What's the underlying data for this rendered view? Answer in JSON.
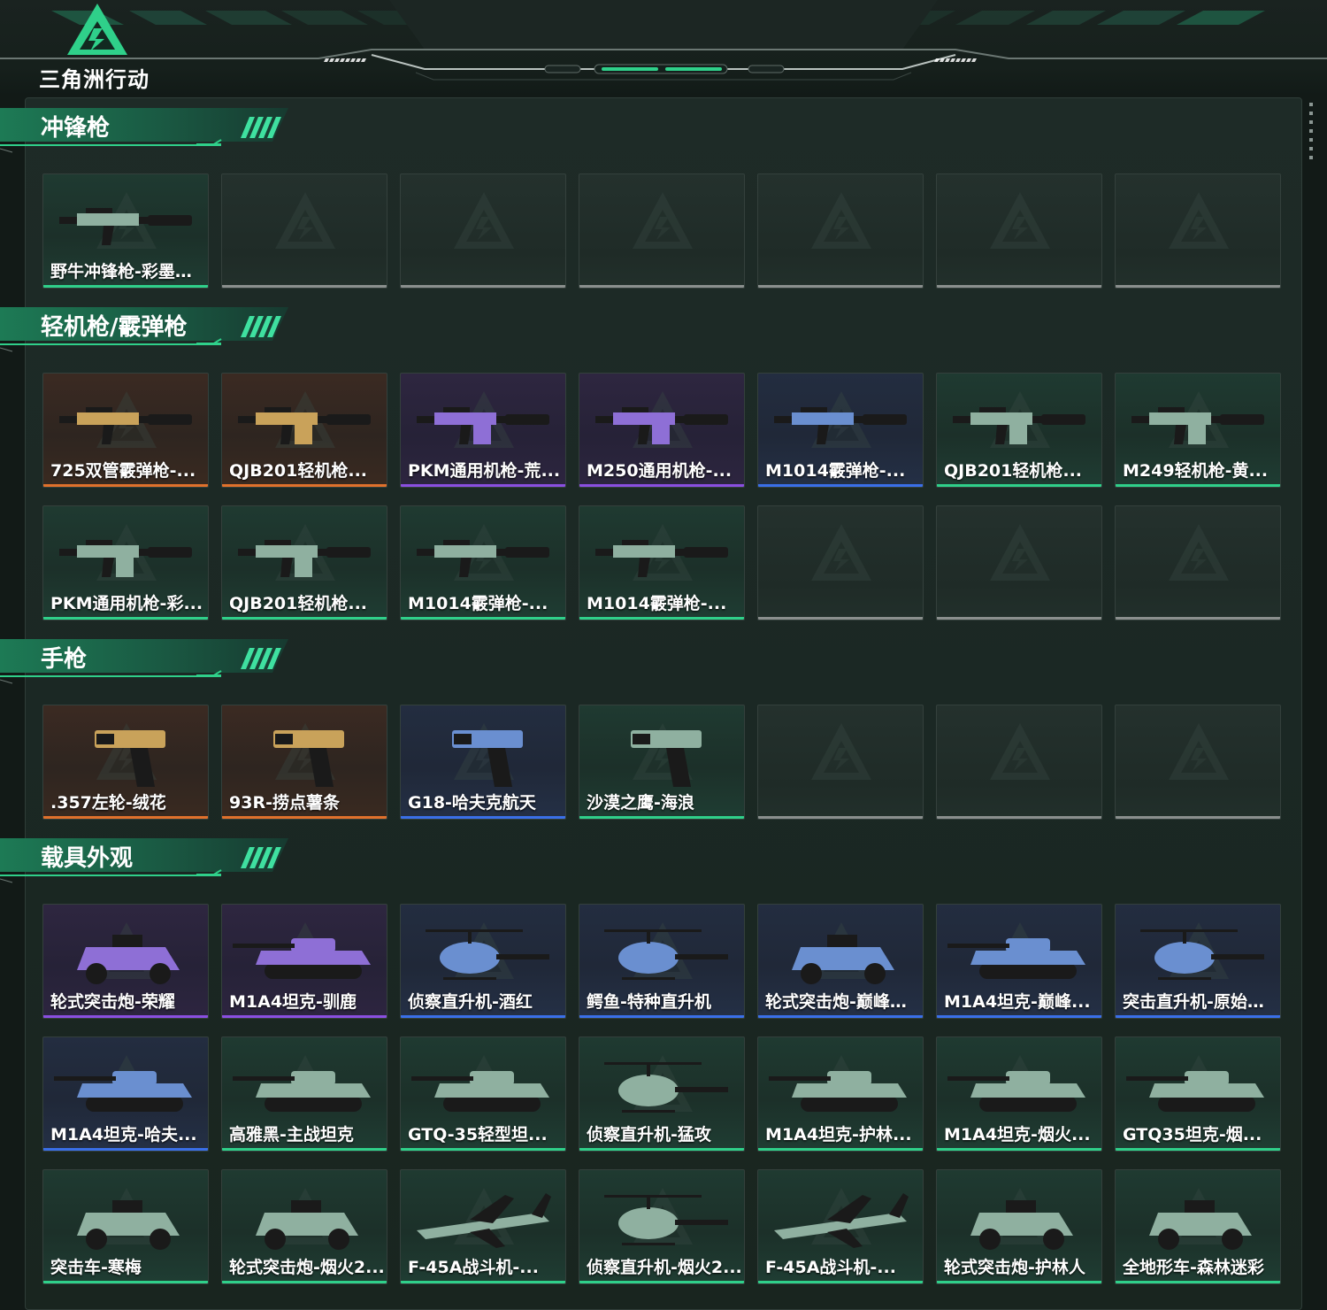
{
  "app": {
    "title": "三角洲行动"
  },
  "colors": {
    "accent": "#2fd08a",
    "rarity_orange": "#e0712c",
    "rarity_purple": "#8a4fe0",
    "rarity_blue": "#3a6fe8",
    "rarity_green": "#2fd08a"
  },
  "sections": [
    {
      "title": "冲锋枪",
      "rows": [
        [
          {
            "label": "野牛冲锋枪-彩墨喷...",
            "rarity": "green",
            "icon": "smg-icon"
          },
          {
            "label": "",
            "rarity": "empty"
          },
          {
            "label": "",
            "rarity": "empty"
          },
          {
            "label": "",
            "rarity": "empty"
          },
          {
            "label": "",
            "rarity": "empty"
          },
          {
            "label": "",
            "rarity": "empty"
          },
          {
            "label": "",
            "rarity": "empty"
          }
        ]
      ]
    },
    {
      "title": "轻机枪/霰弹枪",
      "rows": [
        [
          {
            "label": "725双管霰弹枪-...",
            "rarity": "orange",
            "icon": "shotgun-icon"
          },
          {
            "label": "QJB201轻机枪...",
            "rarity": "orange",
            "icon": "lmg-icon"
          },
          {
            "label": "PKM通用机枪-荒...",
            "rarity": "purple",
            "icon": "lmg-icon"
          },
          {
            "label": "M250通用机枪-...",
            "rarity": "purple",
            "icon": "lmg-icon"
          },
          {
            "label": "M1014霰弹枪-...",
            "rarity": "blue",
            "icon": "shotgun-icon"
          },
          {
            "label": "QJB201轻机枪...",
            "rarity": "green",
            "icon": "lmg-icon"
          },
          {
            "label": "M249轻机枪-黄...",
            "rarity": "green",
            "icon": "lmg-icon"
          }
        ],
        [
          {
            "label": "PKM通用机枪-彩...",
            "rarity": "green",
            "icon": "lmg-icon"
          },
          {
            "label": "QJB201轻机枪...",
            "rarity": "green",
            "icon": "lmg-icon"
          },
          {
            "label": "M1014霰弹枪-...",
            "rarity": "green",
            "icon": "shotgun-icon"
          },
          {
            "label": "M1014霰弹枪-...",
            "rarity": "green",
            "icon": "shotgun-icon"
          },
          {
            "label": "",
            "rarity": "empty"
          },
          {
            "label": "",
            "rarity": "empty"
          },
          {
            "label": "",
            "rarity": "empty"
          }
        ]
      ]
    },
    {
      "title": "手枪",
      "rows": [
        [
          {
            "label": ".357左轮-绒花",
            "rarity": "orange",
            "icon": "pistol-icon"
          },
          {
            "label": "93R-捞点薯条",
            "rarity": "orange",
            "icon": "pistol-icon"
          },
          {
            "label": "G18-哈夫克航天",
            "rarity": "blue",
            "icon": "pistol-icon"
          },
          {
            "label": "沙漠之鹰-海浪",
            "rarity": "green",
            "icon": "pistol-icon"
          },
          {
            "label": "",
            "rarity": "empty"
          },
          {
            "label": "",
            "rarity": "empty"
          },
          {
            "label": "",
            "rarity": "empty"
          }
        ]
      ]
    },
    {
      "title": "载具外观",
      "rows": [
        [
          {
            "label": "轮式突击炮-荣耀",
            "rarity": "purple",
            "icon": "armored-car-icon"
          },
          {
            "label": "M1A4坦克-驯鹿",
            "rarity": "purple",
            "icon": "tank-icon"
          },
          {
            "label": "侦察直升机-酒红",
            "rarity": "blue",
            "icon": "helicopter-icon"
          },
          {
            "label": "鳄鱼-特种直升机",
            "rarity": "blue",
            "icon": "helicopter-icon"
          },
          {
            "label": "轮式突击炮-巅峰竞...",
            "rarity": "blue",
            "icon": "armored-car-icon"
          },
          {
            "label": "M1A4坦克-巅峰...",
            "rarity": "blue",
            "icon": "tank-icon"
          },
          {
            "label": "突击直升机-原始伪...",
            "rarity": "blue",
            "icon": "helicopter-icon"
          }
        ],
        [
          {
            "label": "M1A4坦克-哈夫...",
            "rarity": "blue",
            "icon": "tank-icon"
          },
          {
            "label": "高雅黑-主战坦克",
            "rarity": "green",
            "icon": "tank-icon"
          },
          {
            "label": "GTQ-35轻型坦...",
            "rarity": "green",
            "icon": "tank-icon"
          },
          {
            "label": "侦察直升机-猛攻",
            "rarity": "green",
            "icon": "helicopter-icon"
          },
          {
            "label": "M1A4坦克-护林...",
            "rarity": "green",
            "icon": "tank-icon"
          },
          {
            "label": "M1A4坦克-烟火...",
            "rarity": "green",
            "icon": "tank-icon"
          },
          {
            "label": "GTQ35坦克-烟...",
            "rarity": "green",
            "icon": "tank-icon"
          }
        ],
        [
          {
            "label": "突击车-寒梅",
            "rarity": "green",
            "icon": "armored-car-icon"
          },
          {
            "label": "轮式突击炮-烟火2...",
            "rarity": "green",
            "icon": "armored-car-icon"
          },
          {
            "label": "F-45A战斗机-...",
            "rarity": "green",
            "icon": "jet-icon"
          },
          {
            "label": "侦察直升机-烟火2...",
            "rarity": "green",
            "icon": "helicopter-icon"
          },
          {
            "label": "F-45A战斗机-...",
            "rarity": "green",
            "icon": "jet-icon"
          },
          {
            "label": "轮式突击炮-护林人",
            "rarity": "green",
            "icon": "armored-car-icon"
          },
          {
            "label": "全地形车-森林迷彩",
            "rarity": "green",
            "icon": "atv-icon"
          }
        ]
      ]
    }
  ]
}
